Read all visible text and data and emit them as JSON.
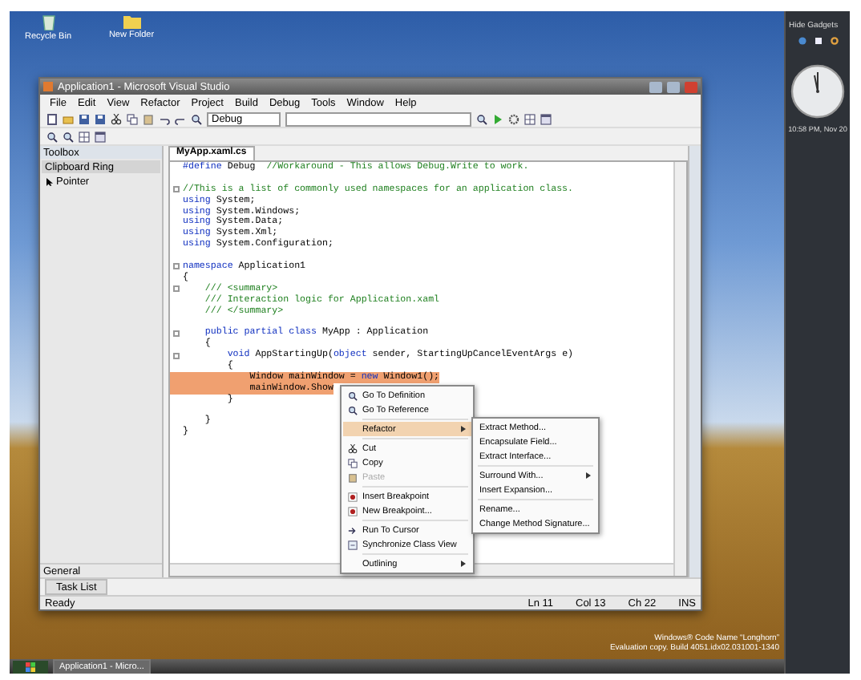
{
  "desktop_icons": [
    {
      "label": "Recycle Bin",
      "kind": "bin"
    },
    {
      "label": "New Folder",
      "kind": "folder"
    }
  ],
  "window": {
    "title": "Application1 - Microsoft Visual Studio",
    "menu": [
      "File",
      "Edit",
      "View",
      "Refactor",
      "Project",
      "Build",
      "Debug",
      "Tools",
      "Window",
      "Help"
    ],
    "configuration": "Debug",
    "toolbox": {
      "title": "Toolbox",
      "group": "Clipboard Ring",
      "items": [
        "Pointer"
      ],
      "footer": "General"
    },
    "editor": {
      "tab": "MyApp.xaml.cs",
      "lines": [
        {
          "fold": false,
          "highlighted": false,
          "parts": [
            {
              "kind": "keyword",
              "text": "#define"
            },
            {
              "kind": "plain",
              "text": " Debug  "
            },
            {
              "kind": "comment",
              "text": "//Workaround - This allows Debug.Write to work."
            }
          ]
        },
        {
          "fold": false,
          "highlighted": false
        },
        {
          "fold": true,
          "highlighted": false,
          "parts": [
            {
              "kind": "comment",
              "text": "//This is a list of commonly used namespaces for an application class."
            }
          ]
        },
        {
          "fold": false,
          "highlighted": false,
          "parts": [
            {
              "kind": "keyword",
              "text": "using"
            },
            {
              "kind": "plain",
              "text": " System;"
            }
          ]
        },
        {
          "fold": false,
          "highlighted": false,
          "parts": [
            {
              "kind": "keyword",
              "text": "using"
            },
            {
              "kind": "plain",
              "text": " System.Windows;"
            }
          ]
        },
        {
          "fold": false,
          "highlighted": false,
          "parts": [
            {
              "kind": "keyword",
              "text": "using"
            },
            {
              "kind": "plain",
              "text": " System.Data;"
            }
          ]
        },
        {
          "fold": false,
          "highlighted": false,
          "parts": [
            {
              "kind": "keyword",
              "text": "using"
            },
            {
              "kind": "plain",
              "text": " System.Xml;"
            }
          ]
        },
        {
          "fold": false,
          "highlighted": false,
          "parts": [
            {
              "kind": "keyword",
              "text": "using"
            },
            {
              "kind": "plain",
              "text": " System.Configuration;"
            }
          ]
        },
        {
          "fold": false,
          "highlighted": false
        },
        {
          "fold": true,
          "highlighted": false,
          "parts": [
            {
              "kind": "keyword",
              "text": "namespace"
            },
            {
              "kind": "plain",
              "text": " Application1"
            }
          ]
        },
        {
          "fold": false,
          "highlighted": false,
          "parts": [
            {
              "kind": "plain",
              "text": "{"
            }
          ]
        },
        {
          "fold": true,
          "highlighted": false,
          "parts": [
            {
              "kind": "comment",
              "text": "    /// <summary>"
            }
          ]
        },
        {
          "fold": false,
          "highlighted": false,
          "parts": [
            {
              "kind": "comment",
              "text": "    /// Interaction logic for Application.xaml"
            }
          ]
        },
        {
          "fold": false,
          "highlighted": false,
          "parts": [
            {
              "kind": "comment",
              "text": "    /// </summary>"
            }
          ]
        },
        {
          "fold": false,
          "highlighted": false
        },
        {
          "fold": true,
          "highlighted": false,
          "parts": [
            {
              "kind": "keyword",
              "text": "    public partial class"
            },
            {
              "kind": "plain",
              "text": " MyApp : Application"
            }
          ]
        },
        {
          "fold": false,
          "highlighted": false,
          "parts": [
            {
              "kind": "plain",
              "text": "    {"
            }
          ]
        },
        {
          "fold": true,
          "highlighted": false,
          "parts": [
            {
              "kind": "keyword",
              "text": "        void"
            },
            {
              "kind": "plain",
              "text": " AppStartingUp("
            },
            {
              "kind": "keyword",
              "text": "object"
            },
            {
              "kind": "plain",
              "text": " sender, StartingUpCancelEventArgs e)"
            }
          ]
        },
        {
          "fold": false,
          "highlighted": false,
          "parts": [
            {
              "kind": "plain",
              "text": "        {"
            }
          ]
        },
        {
          "fold": false,
          "highlighted": true,
          "parts": [
            {
              "kind": "plain",
              "text": "            Window mainWindow = "
            },
            {
              "kind": "keyword",
              "text": "new"
            },
            {
              "kind": "plain",
              "text": " Window1();"
            }
          ]
        },
        {
          "fold": false,
          "highlighted": true,
          "parts": [
            {
              "kind": "plain",
              "text": "            mainWindow.Show"
            }
          ]
        },
        {
          "fold": false,
          "highlighted": false,
          "parts": [
            {
              "kind": "plain",
              "text": "        }"
            }
          ]
        },
        {
          "fold": false,
          "highlighted": false
        },
        {
          "fold": false,
          "highlighted": false,
          "parts": [
            {
              "kind": "plain",
              "text": "    }"
            }
          ]
        },
        {
          "fold": false,
          "highlighted": false,
          "parts": [
            {
              "kind": "plain",
              "text": "}"
            }
          ]
        }
      ]
    },
    "context_menu": [
      {
        "kind": "item",
        "label": "Go To Definition",
        "submenu": false,
        "selected": false,
        "disabled": false
      },
      {
        "kind": "item",
        "label": "Go To Reference",
        "submenu": false,
        "selected": false,
        "disabled": false
      },
      {
        "kind": "separator"
      },
      {
        "kind": "item",
        "label": "Refactor",
        "submenu": true,
        "selected": true,
        "disabled": false
      },
      {
        "kind": "separator"
      },
      {
        "kind": "item",
        "label": "Cut",
        "submenu": false,
        "selected": false,
        "disabled": false
      },
      {
        "kind": "item",
        "label": "Copy",
        "submenu": false,
        "selected": false,
        "disabled": false
      },
      {
        "kind": "item",
        "label": "Paste",
        "submenu": false,
        "selected": false,
        "disabled": true
      },
      {
        "kind": "separator"
      },
      {
        "kind": "item",
        "label": "Insert Breakpoint",
        "submenu": false,
        "selected": false,
        "disabled": false
      },
      {
        "kind": "item",
        "label": "New Breakpoint...",
        "submenu": false,
        "selected": false,
        "disabled": false
      },
      {
        "kind": "separator"
      },
      {
        "kind": "item",
        "label": "Run To Cursor",
        "submenu": false,
        "selected": false,
        "disabled": false
      },
      {
        "kind": "item",
        "label": "Synchronize Class View",
        "submenu": false,
        "selected": false,
        "disabled": false
      },
      {
        "kind": "separator"
      },
      {
        "kind": "item",
        "label": "Outlining",
        "submenu": true,
        "selected": false,
        "disabled": false
      }
    ],
    "submenu": [
      {
        "kind": "item",
        "label": "Extract Method...",
        "submenu": false
      },
      {
        "kind": "item",
        "label": "Encapsulate Field...",
        "submenu": false
      },
      {
        "kind": "item",
        "label": "Extract Interface...",
        "submenu": false
      },
      {
        "kind": "separator"
      },
      {
        "kind": "item",
        "label": "Surround With...",
        "submenu": true
      },
      {
        "kind": "item",
        "label": "Insert Expansion...",
        "submenu": false
      },
      {
        "kind": "separator"
      },
      {
        "kind": "item",
        "label": "Rename...",
        "submenu": false
      },
      {
        "kind": "item",
        "label": "Change Method Signature...",
        "submenu": false
      }
    ],
    "bottom_tab": "Task List",
    "status_bar": {
      "message": "Ready",
      "fields": [
        "Ln 11",
        "Col 13",
        "Ch 22",
        "INS"
      ]
    }
  },
  "build_info": [
    "Windows® Code Name “Longhorn”",
    "Evaluation copy. Build 4051.idx02.031001-1340"
  ],
  "taskbar": {
    "tasks": [
      {
        "label": "Application1 - Micro...",
        "selected": true
      }
    ]
  },
  "sidebar": {
    "header": "Hide Gadgets",
    "clock_caption": "10:58 PM, Nov 20"
  }
}
